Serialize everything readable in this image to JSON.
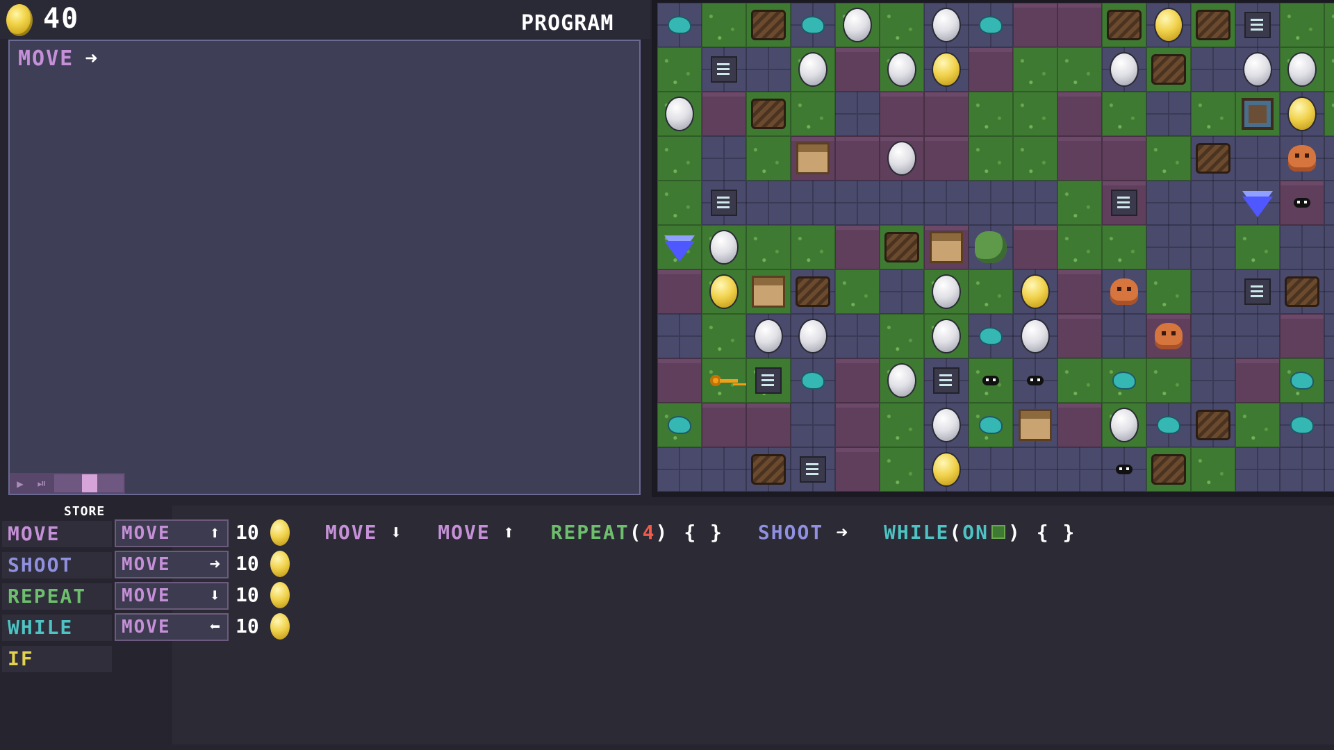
{
  "hud": {
    "coins": "40",
    "program_title": "PROGRAM"
  },
  "program": {
    "lines": [
      {
        "label": "MOVE",
        "arrow": "➜"
      }
    ]
  },
  "store": {
    "title": "STORE",
    "categories": [
      "MOVE",
      "SHOOT",
      "REPEAT",
      "WHILE",
      "IF"
    ],
    "items": [
      {
        "label": "MOVE",
        "arrow": "⬆",
        "price": "10"
      },
      {
        "label": "MOVE",
        "arrow": "➜",
        "price": "10"
      },
      {
        "label": "MOVE",
        "arrow": "⬇",
        "price": "10"
      },
      {
        "label": "MOVE",
        "arrow": "⬅",
        "price": "10"
      }
    ]
  },
  "palette": {
    "move_down": {
      "label": "MOVE",
      "arrow": "⬇"
    },
    "move_up": {
      "label": "MOVE",
      "arrow": "⬆"
    },
    "repeat": {
      "label": "REPEAT",
      "open": "(",
      "count": "4",
      "close": ")",
      "braces": "{ }"
    },
    "shoot": {
      "label": "SHOOT",
      "arrow": "➜"
    },
    "while": {
      "label": "WHILE",
      "open": "(",
      "cond": "ON",
      "close": ")",
      "braces": "{ }"
    }
  },
  "colors": {
    "move": "#c590d8",
    "shoot": "#9090e0",
    "repeat": "#6dbf6d",
    "while": "#4fc3c3",
    "if": "#e3d24f"
  }
}
